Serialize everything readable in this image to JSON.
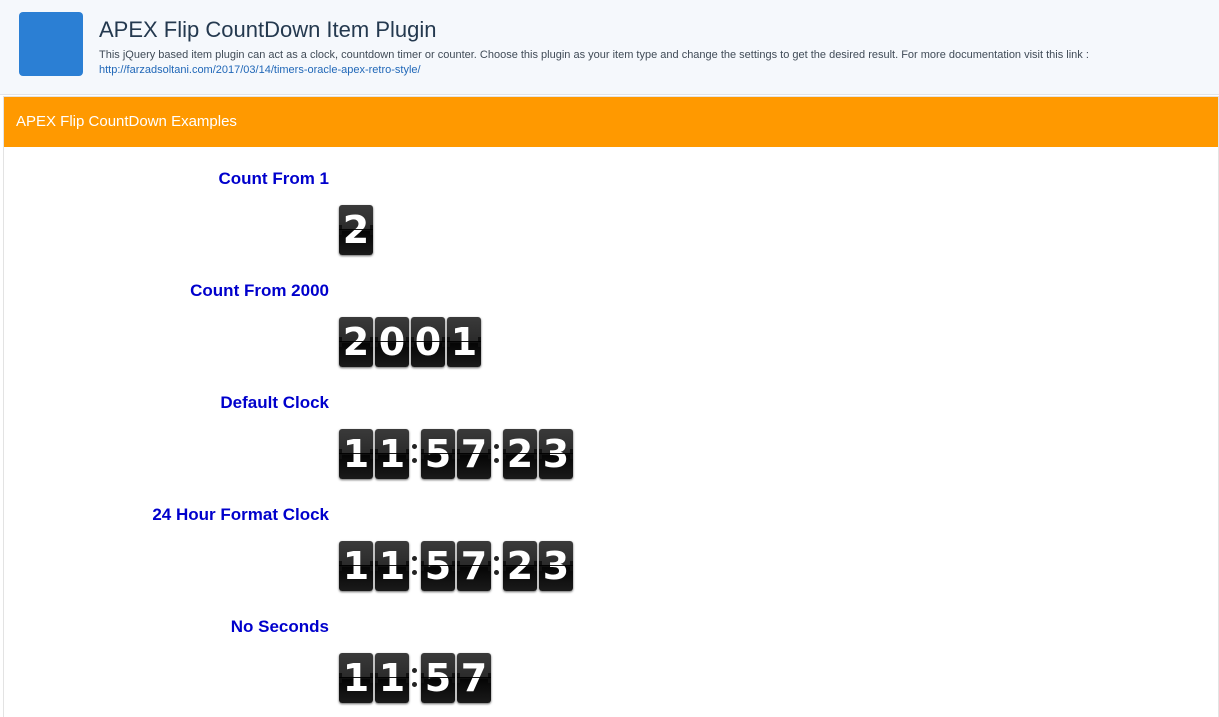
{
  "colors": {
    "accent_orange": "#ff9900",
    "app_icon_blue": "#2b7fd4",
    "label_blue": "#0000cc",
    "link_blue": "#2168b8"
  },
  "header": {
    "icon": "app-square-icon",
    "title": "APEX Flip CountDown Item Plugin",
    "description": "This jQuery based item plugin can act as a clock, countdown timer or counter. Choose this plugin as your item type and change the settings to get the desired result. For more documentation visit this link :",
    "link": "http://farzadsoltani.com/2017/03/14/timers-oracle-apex-retro-style/"
  },
  "region": {
    "title": "APEX Flip CountDown Examples"
  },
  "items": [
    {
      "label": "Count From 1",
      "digits": [
        "2"
      ]
    },
    {
      "label": "Count From 2000",
      "digits": [
        "2",
        "0",
        "0",
        "1"
      ]
    },
    {
      "label": "Default Clock",
      "digits": [
        "1",
        "1",
        ":",
        "5",
        "7",
        ":",
        "2",
        "3"
      ]
    },
    {
      "label": "24 Hour Format Clock",
      "digits": [
        "1",
        "1",
        ":",
        "5",
        "7",
        ":",
        "2",
        "3"
      ]
    },
    {
      "label": "No Seconds",
      "digits": [
        "1",
        "1",
        ":",
        "5",
        "7"
      ]
    }
  ]
}
